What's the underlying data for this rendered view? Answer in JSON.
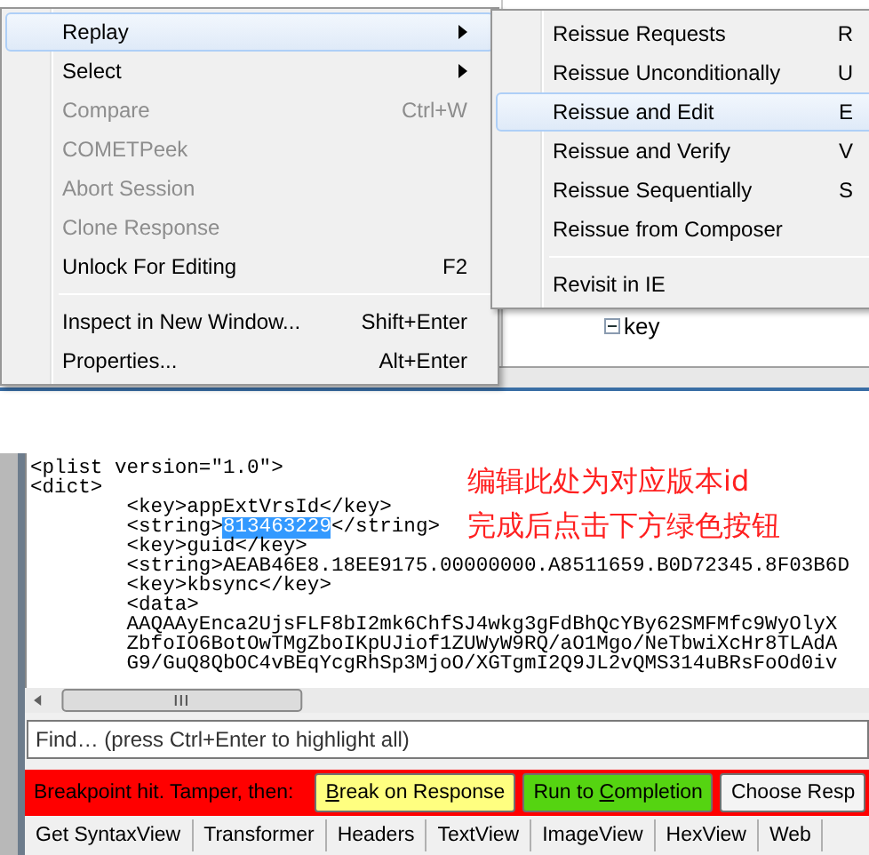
{
  "background_tree": {
    "node": "key"
  },
  "context_menu": {
    "items": [
      {
        "kind": "item",
        "label": "Replay",
        "submenu": true,
        "disabled": false,
        "selected": true
      },
      {
        "kind": "item",
        "label": "Select",
        "submenu": true,
        "disabled": false,
        "selected": false
      },
      {
        "kind": "item",
        "label": "Compare",
        "shortcut": "Ctrl+W",
        "disabled": true,
        "selected": false
      },
      {
        "kind": "item",
        "label": "COMETPeek",
        "disabled": true,
        "selected": false
      },
      {
        "kind": "item",
        "label": "Abort Session",
        "disabled": true,
        "selected": false
      },
      {
        "kind": "item",
        "label": "Clone Response",
        "disabled": true,
        "selected": false
      },
      {
        "kind": "item",
        "label": "Unlock For Editing",
        "shortcut": "F2",
        "disabled": false,
        "selected": false
      },
      {
        "kind": "separator"
      },
      {
        "kind": "item",
        "label": "Inspect in New Window...",
        "shortcut": "Shift+Enter",
        "disabled": false,
        "selected": false
      },
      {
        "kind": "item",
        "label": "Properties...",
        "shortcut": "Alt+Enter",
        "disabled": false,
        "selected": false
      }
    ]
  },
  "submenu": {
    "items": [
      {
        "kind": "item",
        "label": "Reissue Requests",
        "shortcut": "R",
        "selected": false
      },
      {
        "kind": "item",
        "label": "Reissue Unconditionally",
        "shortcut": "U",
        "selected": false
      },
      {
        "kind": "item",
        "label": "Reissue and Edit",
        "shortcut": "E",
        "selected": true
      },
      {
        "kind": "item",
        "label": "Reissue and Verify",
        "shortcut": "V",
        "selected": false
      },
      {
        "kind": "item",
        "label": "Reissue Sequentially",
        "shortcut": "S",
        "selected": false
      },
      {
        "kind": "item",
        "label": "Reissue from Composer",
        "selected": false
      },
      {
        "kind": "separator"
      },
      {
        "kind": "item",
        "label": "Revisit in IE",
        "selected": false
      }
    ]
  },
  "editor": {
    "lines": [
      {
        "text": "<plist version=\"1.0\">"
      },
      {
        "text": "<dict>"
      },
      {
        "text": "\t<key>appExtVrsId</key>"
      },
      {
        "parts": [
          {
            "text": "\t<string>",
            "selected": false
          },
          {
            "text": "813463229",
            "selected": true
          },
          {
            "text": "</string>",
            "selected": false
          }
        ]
      },
      {
        "text": "\t<key>guid</key>"
      },
      {
        "text": "\t<string>AEAB46E8.18EE9175.00000000.A8511659.B0D72345.8F03B6D"
      },
      {
        "text": "\t<key>kbsync</key>"
      },
      {
        "text": "\t<data>"
      },
      {
        "text": "\tAAQAAyEnca2UjsFLF8bI2mk6ChfSJ4wkg3gFdBhQcYBy62SMFMfc9WyOlyX"
      },
      {
        "text": "\tZbfoIO6BotOwTMgZboIKpUJiof1ZUWyW9RQ/aO1Mgo/NeTbwiXcHr8TLAdA"
      },
      {
        "text": "\tG9/GuQ8QbOC4vBEqYcgRhSp3MjoO/XGTgmI2Q9JL2vQMS314uBRsFoOd0iv"
      }
    ],
    "annotation": [
      "编辑此处为对应版本id",
      "完成后点击下方绿色按钮"
    ]
  },
  "find": {
    "placeholder": "Find… (press Ctrl+Enter to highlight all)"
  },
  "breakpoint_bar": {
    "message": "Breakpoint hit. Tamper, then:",
    "buttons": [
      {
        "parts": [
          {
            "text": "B",
            "underlined": true
          },
          {
            "text": "reak on Response",
            "underlined": false
          }
        ],
        "color": "#ffff80"
      },
      {
        "parts": [
          {
            "text": "Run to ",
            "underlined": false
          },
          {
            "text": "C",
            "underlined": true
          },
          {
            "text": "ompletion",
            "underlined": false
          }
        ],
        "color": "#55d411"
      },
      {
        "parts": [
          {
            "text": "Choose Resp",
            "underlined": false
          }
        ],
        "color": "#f4f4f4"
      }
    ]
  },
  "tabs": [
    "Get SyntaxView",
    "Transformer",
    "Headers",
    "TextView",
    "ImageView",
    "HexView",
    "Web"
  ]
}
